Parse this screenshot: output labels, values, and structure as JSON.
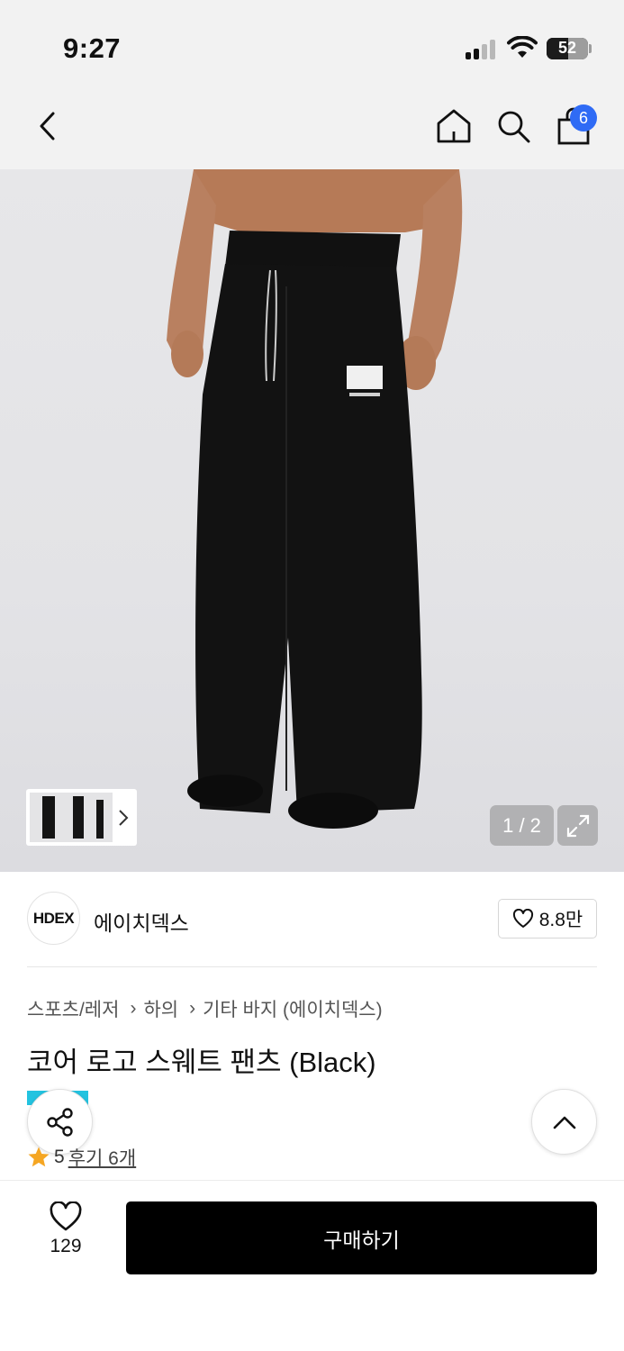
{
  "status_bar": {
    "time": "9:27",
    "battery": "52",
    "icons": [
      "signal-icon",
      "wifi-icon",
      "battery-icon"
    ]
  },
  "nav": {
    "icons": [
      "back-icon",
      "home-icon",
      "search-icon",
      "shopping-bag-icon"
    ],
    "cart_count": "6",
    "badge_color": "#2f6bf5"
  },
  "gallery": {
    "counter": "1 / 2",
    "icons": [
      "chevron-right-icon",
      "expand-icon"
    ]
  },
  "brand": {
    "logo_text": "HDEX",
    "name": "에이치덱스",
    "likes": "8.8만"
  },
  "breadcrumb": [
    "스포츠/레저",
    "하의",
    "기타 바지 (에이치덱스)"
  ],
  "product": {
    "title": "코어 로고 스웨트 팬츠 (Black)",
    "rating": "5",
    "review_link": "후기 6개",
    "star_color": "#f5a623"
  },
  "floating": {
    "icons": [
      "share-icon",
      "chevron-up-icon"
    ]
  },
  "bottom_bar": {
    "wish_count": "129",
    "buy_label": "구매하기"
  }
}
